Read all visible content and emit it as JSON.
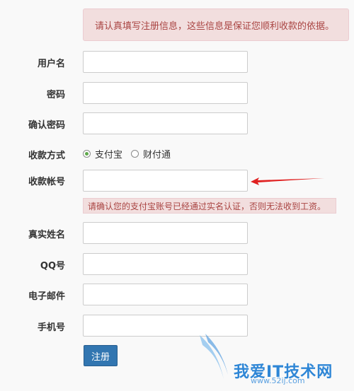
{
  "notice": "请认真填写注册信息，这些信息是保证您顺利收款的依据。",
  "fields": {
    "username": {
      "label": "用户名",
      "value": ""
    },
    "password": {
      "label": "密码",
      "value": ""
    },
    "confirm_password": {
      "label": "确认密码",
      "value": ""
    },
    "payment_method": {
      "label": "收款方式",
      "options": [
        "支付宝",
        "财付通"
      ],
      "selected": "支付宝"
    },
    "account": {
      "label": "收款帐号",
      "value": ""
    },
    "account_warning": "请确认您的支付宝账号已经通过实名认证，否则无法收到工资。",
    "real_name": {
      "label": "真实姓名",
      "value": ""
    },
    "qq": {
      "label": "QQ号",
      "value": ""
    },
    "email": {
      "label": "电子邮件",
      "value": ""
    },
    "phone": {
      "label": "手机号",
      "value": ""
    }
  },
  "submit_label": "注册",
  "watermark": {
    "text": "我爱IT技术网",
    "url": "www.52ij.com"
  },
  "colors": {
    "alert_bg": "#f2dede",
    "alert_text": "#a94442",
    "button": "#3276b1",
    "arrow": "#e02020"
  }
}
